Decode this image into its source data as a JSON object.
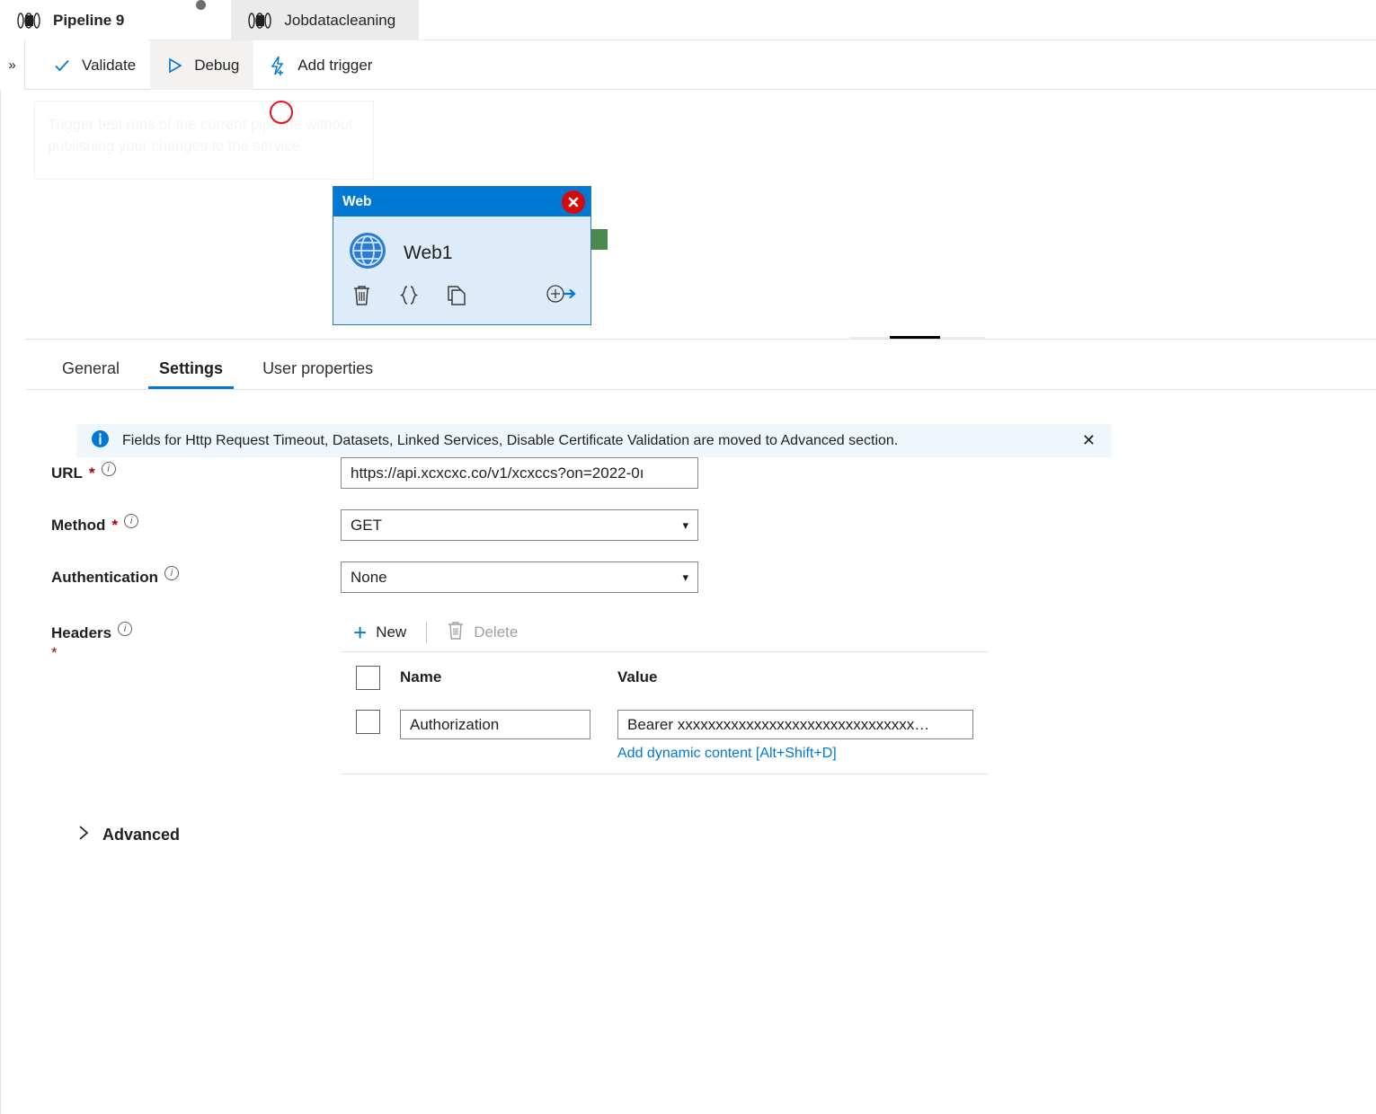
{
  "tabs": [
    {
      "label": "Pipeline 9",
      "icon": "pipeline-icon",
      "active": false,
      "dirty": true
    },
    {
      "label": "Jobdatacleaning",
      "icon": "pipeline-icon",
      "active": true,
      "dirty": false
    }
  ],
  "commandbar": {
    "expand_icon": "double-chevron-right-icon",
    "validate_label": "Validate",
    "debug_label": "Debug",
    "add_trigger_label": "Add trigger"
  },
  "tooltip": {
    "text": "Trigger test runs of the current pipeline without publishing your changes to the service"
  },
  "canvas": {
    "activity": {
      "type_label": "Web",
      "name": "Web1",
      "status": "error",
      "header_color": "#0078d4",
      "body_color": "#deecf9",
      "error_color": "#d60a0a",
      "actions": [
        {
          "name": "delete-activity-icon",
          "glyph": "trash"
        },
        {
          "name": "code-activity-icon",
          "glyph": "braces"
        },
        {
          "name": "clone-activity-icon",
          "glyph": "copy"
        },
        {
          "name": "add-output-icon",
          "glyph": "add-arrow"
        }
      ]
    },
    "success_port_color": "#4a8a4f",
    "fail_marker_color": "#e81123"
  },
  "properties": {
    "tabs": [
      {
        "label": "General",
        "selected": false
      },
      {
        "label": "Settings",
        "selected": true
      },
      {
        "label": "User properties",
        "selected": false
      }
    ],
    "infobar": {
      "icon": "info-icon",
      "message": "Fields for Http Request Timeout, Datasets, Linked Services, Disable Certificate Validation are moved to Advanced section.",
      "close_label": "✕",
      "background": "#eff6fc"
    },
    "fields": {
      "url": {
        "label": "URL",
        "required": true,
        "value": "https://api.xcxcxc.co/v1/xcxccs?on=2022-0ı"
      },
      "method": {
        "label": "Method",
        "required": true,
        "value": "GET"
      },
      "authentication": {
        "label": "Authentication",
        "required": false,
        "value": "None"
      },
      "headers": {
        "label": "Headers",
        "required": true,
        "toolbar": {
          "new_label": "New",
          "delete_label": "Delete",
          "delete_disabled": true
        },
        "columns": [
          "Name",
          "Value"
        ],
        "rows": [
          {
            "name": "Authorization",
            "value": "Bearer xxxxxxxxxxxxxxxxxxxxxxxxxxxxxxx…",
            "dynamic_link": "Add dynamic content [Alt+Shift+D]"
          }
        ]
      }
    },
    "advanced": {
      "label": "Advanced",
      "expanded": false,
      "chevron": "chevron-right-icon"
    }
  }
}
